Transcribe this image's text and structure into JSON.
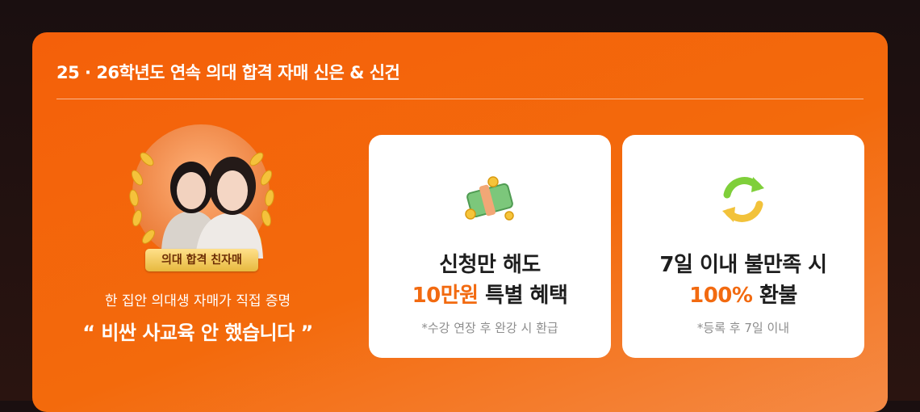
{
  "header": {
    "title": "25 · 26학년도 연속 의대 합격 자매 신은 & 신건"
  },
  "testimonial": {
    "badge": "의대 합격 친자매",
    "subtitle": "한 집안 의대생 자매가 직접 증명",
    "quote": "“ 비싼 사교육 안 했습니다 ”"
  },
  "cards": [
    {
      "icon": "money-icon",
      "line1": "신청만 해도",
      "line2_highlight": "10만원",
      "line2_rest": " 특별 혜택",
      "note": "*수강 연장 후 완강 시 환급"
    },
    {
      "icon": "refresh-icon",
      "line1": "7일 이내 불만족 시",
      "line2_highlight": "100%",
      "line2_rest": " 환불",
      "note": "*등록 후 7일 이내"
    }
  ],
  "colors": {
    "brand": "#F26A10",
    "badge": "#E7B93F"
  }
}
